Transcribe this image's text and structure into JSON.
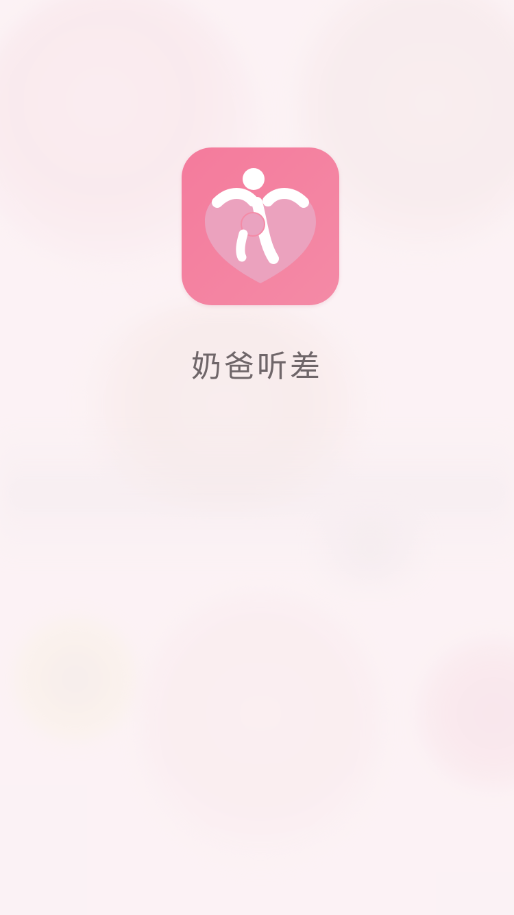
{
  "splash": {
    "app_name": "奶爸听差",
    "icon": "parent-and-baby-heart-logo"
  },
  "colors": {
    "icon_background": "#f47b9c",
    "icon_heart": "#eaa3c0",
    "text": "#6f6669",
    "background": "#fbf1f4"
  }
}
